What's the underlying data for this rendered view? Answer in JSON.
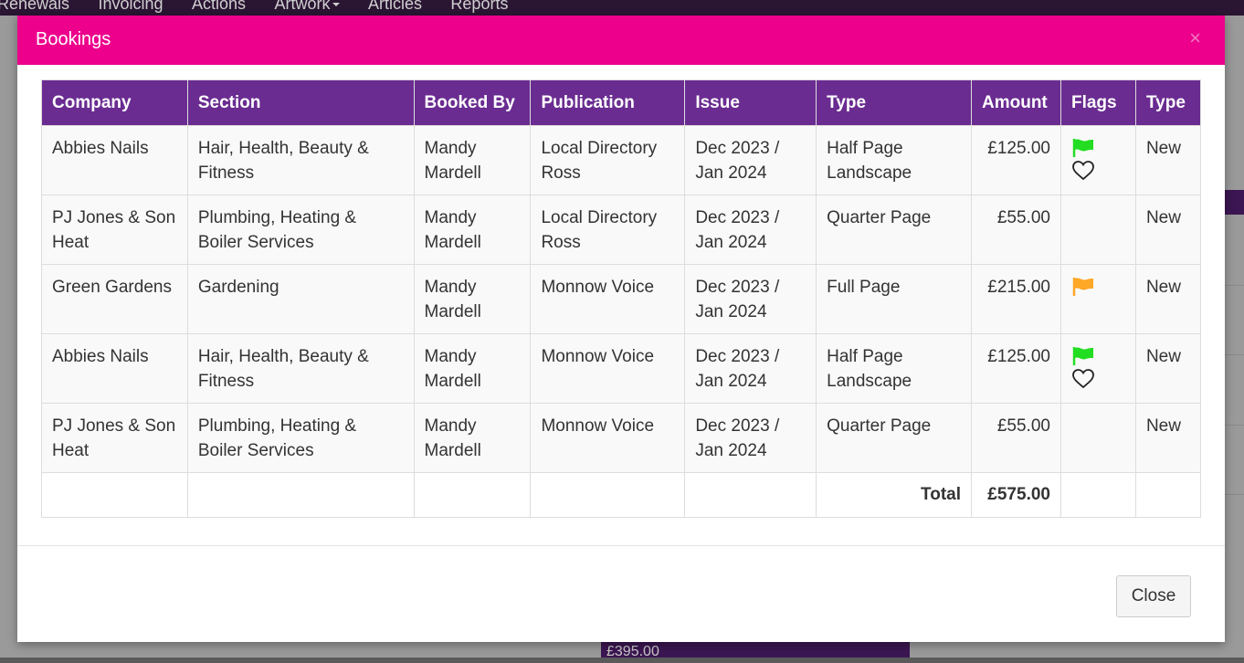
{
  "background": {
    "nav_items": [
      "Renewals",
      "Invoicing",
      "Actions",
      "Artwork",
      "Articles",
      "Reports"
    ],
    "footer_amount": "£395.00"
  },
  "modal": {
    "title": "Bookings",
    "close_icon": "close-icon",
    "columns": [
      "Company",
      "Section",
      "Booked By",
      "Publication",
      "Issue",
      "Type",
      "Amount",
      "Flags",
      "Type"
    ],
    "rows": [
      {
        "company": "Abbies Nails",
        "section": "Hair, Health, Beauty & Fitness",
        "booked_by": "Mandy Mardell",
        "publication": "Local Directory Ross",
        "issue": "Dec 2023 / Jan 2024",
        "type": "Half Page Landscape",
        "amount": "£125.00",
        "flags": [
          "green-flag-icon",
          "heart-icon"
        ],
        "status": "New"
      },
      {
        "company": "PJ Jones & Son Heat",
        "section": "Plumbing, Heating & Boiler Services",
        "booked_by": "Mandy Mardell",
        "publication": "Local Directory Ross",
        "issue": "Dec 2023 / Jan 2024",
        "type": "Quarter Page",
        "amount": "£55.00",
        "flags": [],
        "status": "New"
      },
      {
        "company": "Green Gardens",
        "section": "Gardening",
        "booked_by": "Mandy Mardell",
        "publication": "Monnow Voice",
        "issue": "Dec 2023 / Jan 2024",
        "type": "Full Page",
        "amount": "£215.00",
        "flags": [
          "orange-flag-icon"
        ],
        "status": "New"
      },
      {
        "company": "Abbies Nails",
        "section": "Hair, Health, Beauty & Fitness",
        "booked_by": "Mandy Mardell",
        "publication": "Monnow Voice",
        "issue": "Dec 2023 / Jan 2024",
        "type": "Half Page Landscape",
        "amount": "£125.00",
        "flags": [
          "green-flag-icon",
          "heart-icon"
        ],
        "status": "New"
      },
      {
        "company": "PJ Jones & Son Heat",
        "section": "Plumbing, Heating & Boiler Services",
        "booked_by": "Mandy Mardell",
        "publication": "Monnow Voice",
        "issue": "Dec 2023 / Jan 2024",
        "type": "Quarter Page",
        "amount": "£55.00",
        "flags": [],
        "status": "New"
      }
    ],
    "total_label": "Total",
    "total_value": "£575.00",
    "close_button_label": "Close"
  },
  "colors": {
    "header_pink": "#ec008c",
    "table_header_purple": "#6a2c91",
    "flag_green": "#22dd22",
    "flag_orange": "#ffa726"
  }
}
